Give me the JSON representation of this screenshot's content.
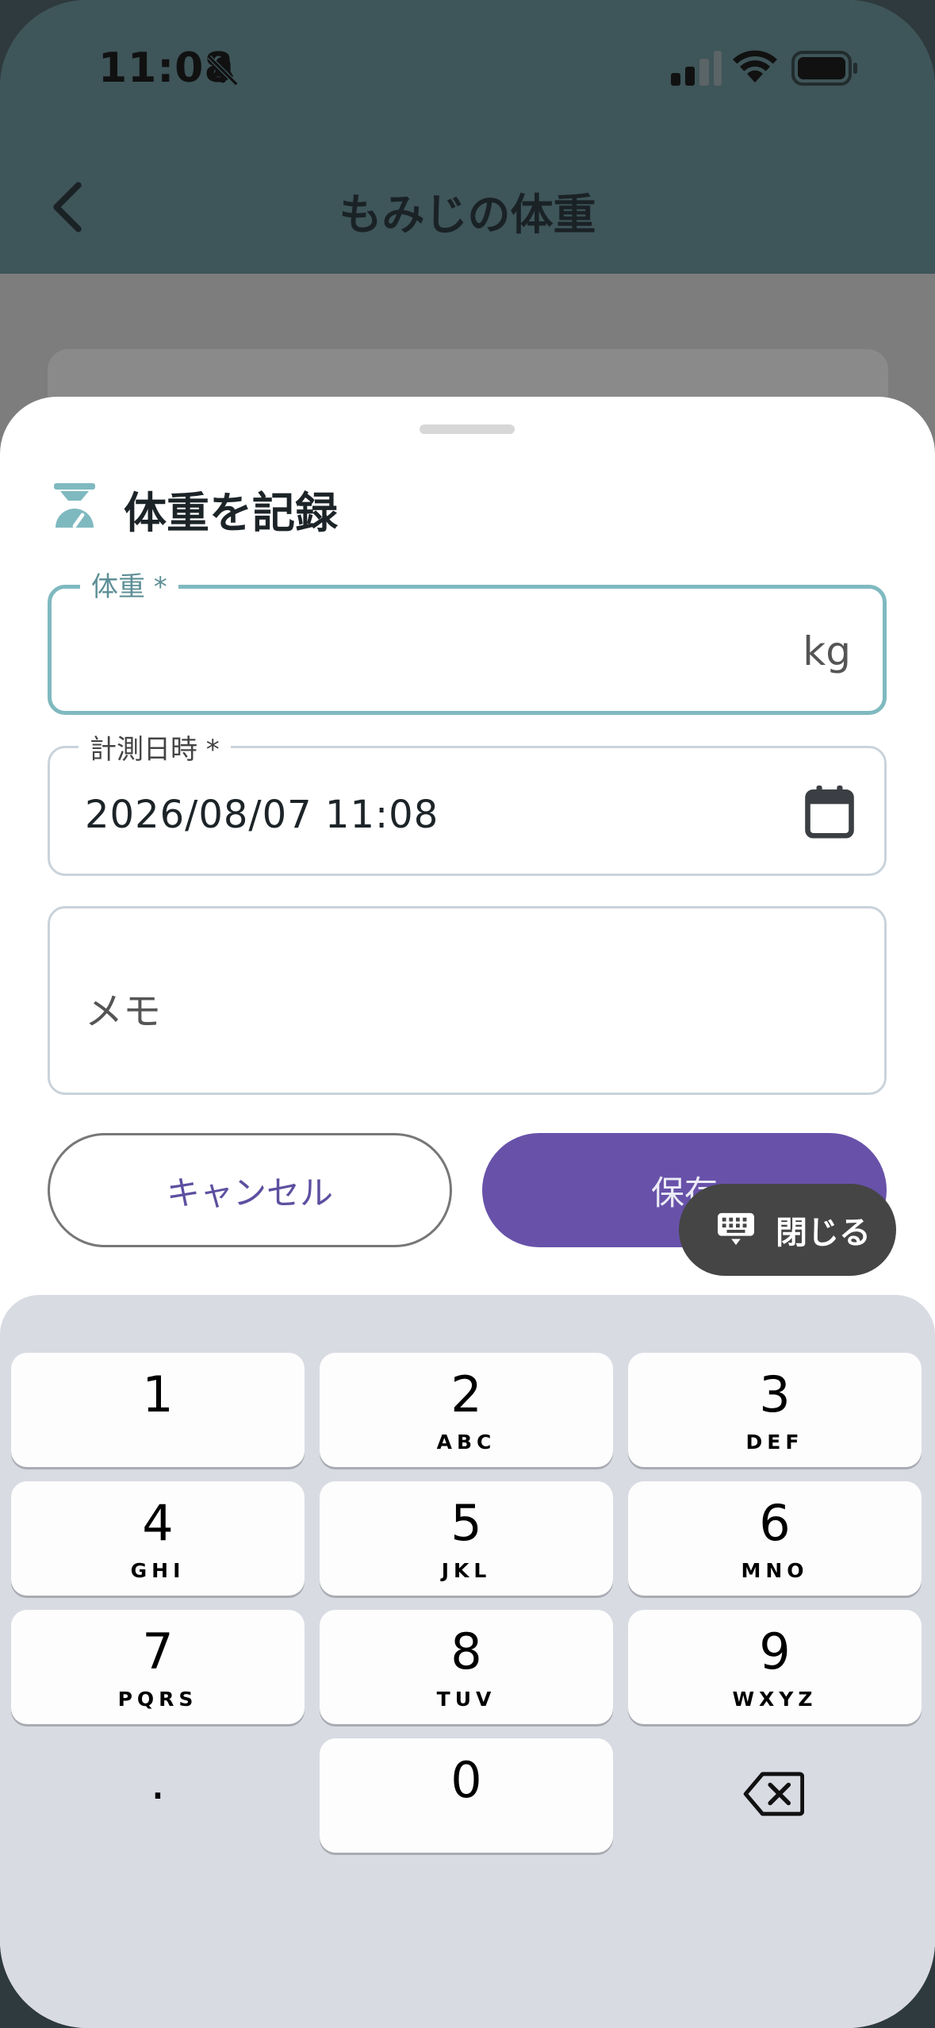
{
  "status_bar": {
    "time": "11:08"
  },
  "header": {
    "title": "もみじの体重"
  },
  "sheet": {
    "title": "体重を記録",
    "weight_field": {
      "label": "体重 *",
      "value": "",
      "unit": "kg"
    },
    "date_field": {
      "label": "計測日時 *",
      "value": "2026/08/07 11:08"
    },
    "memo_field": {
      "placeholder": "メモ"
    },
    "cancel_label": "キャンセル",
    "save_label": "保存",
    "close_keyboard_label": "閉じる"
  },
  "keyboard": {
    "keys": [
      {
        "digit": "1",
        "letters": ""
      },
      {
        "digit": "2",
        "letters": "ABC"
      },
      {
        "digit": "3",
        "letters": "DEF"
      },
      {
        "digit": "4",
        "letters": "GHI"
      },
      {
        "digit": "5",
        "letters": "JKL"
      },
      {
        "digit": "6",
        "letters": "MNO"
      },
      {
        "digit": "7",
        "letters": "PQRS"
      },
      {
        "digit": "8",
        "letters": "TUV"
      },
      {
        "digit": "9",
        "letters": "WXYZ"
      },
      {
        "digit": ".",
        "letters": ""
      },
      {
        "digit": "0",
        "letters": ""
      }
    ]
  },
  "colors": {
    "header_bg": "#3e5559",
    "accent_teal": "#7fb9c0",
    "save_button": "#6852a9",
    "cancel_text": "#5d4fa0"
  }
}
